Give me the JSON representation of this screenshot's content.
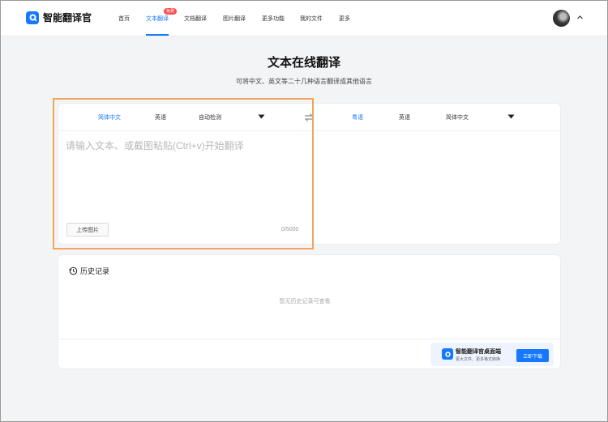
{
  "header": {
    "logo_text": "智能翻译官",
    "nav": [
      {
        "label": "首页"
      },
      {
        "label": "文本翻译",
        "badge": "免费"
      },
      {
        "label": "文档翻译"
      },
      {
        "label": "图片翻译"
      },
      {
        "label": "更多功能"
      },
      {
        "label": "我的文件"
      },
      {
        "label": "更多"
      }
    ]
  },
  "hero": {
    "title": "文本在线翻译",
    "subtitle": "可将中文、英文等二十几种语言翻译成其他语言"
  },
  "translator": {
    "source_langs": [
      "简体中文",
      "英语",
      "自动检测"
    ],
    "target_langs": [
      "粤语",
      "英语",
      "简体中文"
    ],
    "placeholder": "请输入文本、或截图粘贴(Ctrl+v)开始翻译",
    "input_value": "",
    "upload_label": "上传图片",
    "char_count": "0/5000"
  },
  "history": {
    "title": "历史记录",
    "empty_text": "暂无历史记录可查看"
  },
  "promo": {
    "title": "智能翻译官桌面端",
    "subtitle": "更大文件、更多格式转换",
    "button_label": "立即下载"
  },
  "colors": {
    "accent": "#1677ff",
    "badge": "#ff4d4f",
    "highlight": "#f0a55d"
  },
  "icons": {
    "logo": "logo-icon",
    "swap": "swap-icon",
    "history": "history-icon",
    "dropdown": "caret-down-icon",
    "chevron": "chevron-up-icon"
  }
}
